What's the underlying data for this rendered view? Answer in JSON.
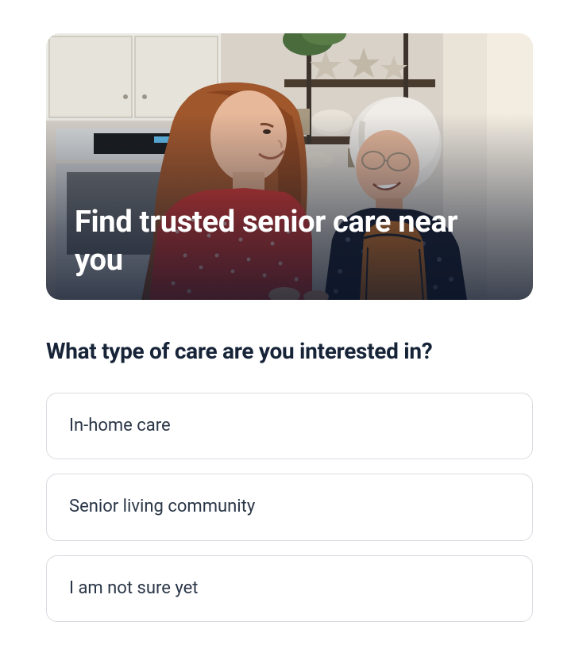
{
  "hero": {
    "title": "Find trusted senior care near you"
  },
  "question": "What type of care are you interested in?",
  "options": [
    {
      "label": "In-home care"
    },
    {
      "label": "Senior living community"
    },
    {
      "label": "I am not sure yet"
    }
  ]
}
